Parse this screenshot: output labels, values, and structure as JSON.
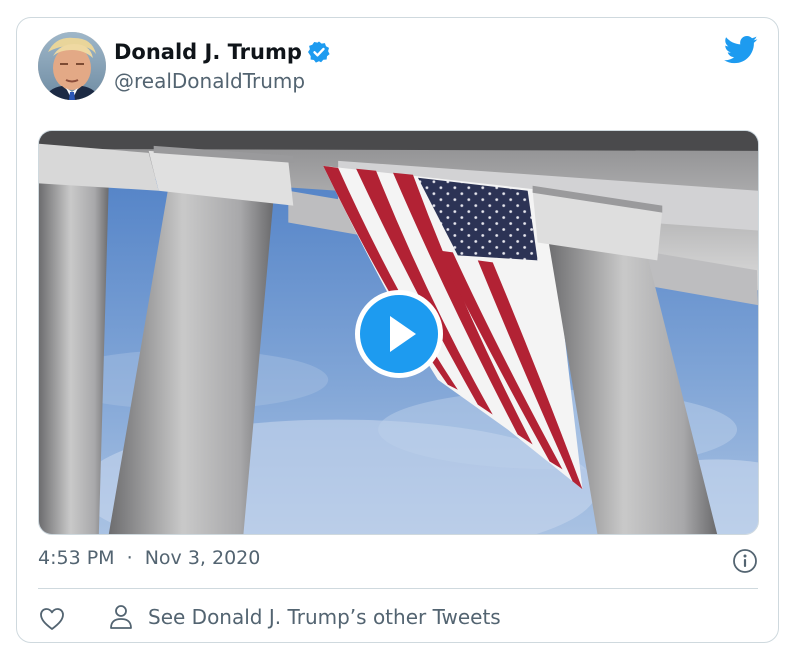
{
  "author": {
    "name": "Donald J. Trump",
    "handle": "@realDonaldTrump",
    "verified": true
  },
  "icons": {
    "brand": "twitter-bird-icon",
    "verified": "verified-badge-icon",
    "play": "play-icon",
    "info": "info-icon",
    "like": "heart-icon",
    "profile": "person-icon"
  },
  "meta": {
    "time": "4:53 PM",
    "separator": "·",
    "date": "Nov 3, 2020"
  },
  "actions": {
    "other_tweets": "See Donald J. Trump’s other Tweets"
  },
  "colors": {
    "accent": "#1d9bf0",
    "text": "#0f1419",
    "secondary": "#536471",
    "border": "#cfd9de"
  }
}
